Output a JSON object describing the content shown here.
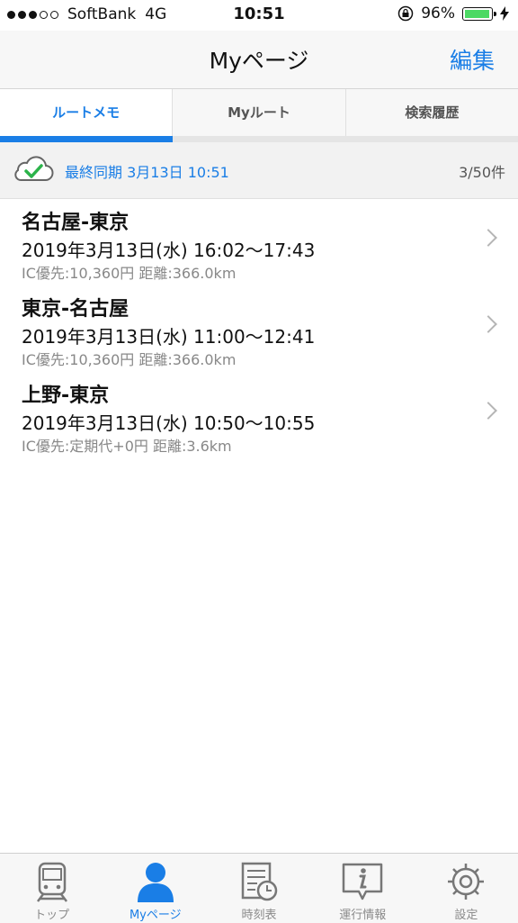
{
  "status": {
    "carrier": "SoftBank",
    "network": "4G",
    "time": "10:51",
    "battery": "96%",
    "battery_level": 0.96
  },
  "nav": {
    "title": "Myページ",
    "edit_label": "編集"
  },
  "tabs": [
    {
      "label": "ルートメモ",
      "active": true
    },
    {
      "label": "Myルート",
      "active": false
    },
    {
      "label": "検索履歴",
      "active": false
    }
  ],
  "sync": {
    "text": "最終同期 3月13日 10:51",
    "count": "3/50件"
  },
  "routes": [
    {
      "name": "名古屋-東京",
      "datetime": "2019年3月13日(水) 16:02〜17:43",
      "detail": "IC優先:10,360円 距離:366.0km"
    },
    {
      "name": "東京-名古屋",
      "datetime": "2019年3月13日(水) 11:00〜12:41",
      "detail": "IC優先:10,360円 距離:366.0km"
    },
    {
      "name": "上野-東京",
      "datetime": "2019年3月13日(水) 10:50〜10:55",
      "detail": "IC優先:定期代+0円 距離:3.6km"
    }
  ],
  "tabbar": [
    {
      "label": "トップ",
      "icon": "train-icon",
      "active": false
    },
    {
      "label": "Myページ",
      "icon": "person-icon",
      "active": true
    },
    {
      "label": "時刻表",
      "icon": "timetable-icon",
      "active": false
    },
    {
      "label": "運行情報",
      "icon": "info-icon",
      "active": false
    },
    {
      "label": "設定",
      "icon": "gear-icon",
      "active": false
    }
  ],
  "colors": {
    "accent": "#1a7ee6",
    "check": "#2bb34a",
    "battery": "#4cd964"
  }
}
